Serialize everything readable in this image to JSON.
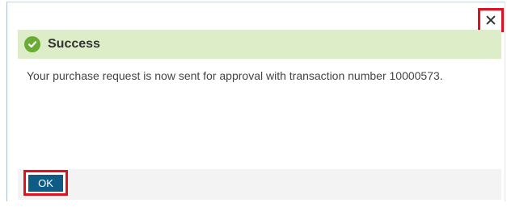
{
  "dialog": {
    "close_icon": "close-icon",
    "title": "Success",
    "status_icon": "check-circle-icon",
    "message": "Your purchase request is now sent for approval with transaction number 10000573.",
    "ok_label": "OK"
  },
  "colors": {
    "success_bg": "#dcedc8",
    "success_icon": "#6aab33",
    "button_bg": "#0e5c86",
    "highlight_border": "#e01020"
  }
}
